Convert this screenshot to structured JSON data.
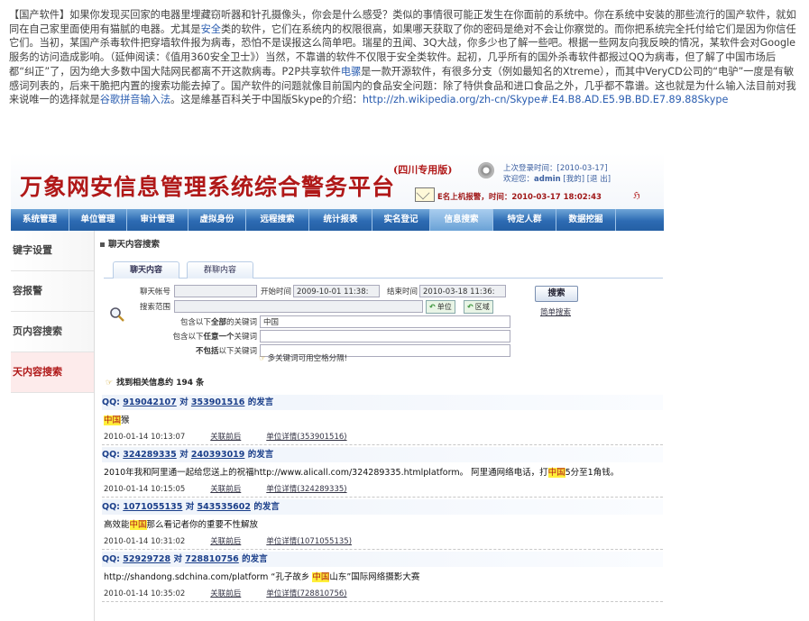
{
  "article": {
    "segments": [
      {
        "t": "【国产软件】如果你发现买回家的电器里埋藏窃听器和针孔摄像头，你会是什么感受？类似的事情很可能正发生在你面前的系统中。你在系统中安装的那些流行的国产软件，就如同在自己家里面使用有猫腻的电器。尤其是",
        "k": false
      },
      {
        "t": "安全",
        "k": true
      },
      {
        "t": "类的软件，它们在系统内的权限很高，如果哪天获取了你的密码是绝对不会让你察觉的。而你把系统完全托付给它们是因为你信任它们。当初，某国产杀毒软件把穿墙软件报为病毒，恐怕不是误报这么简单吧。瑞星的丑闻、3Q大战，你多少也了解一些吧。根据一些网友向我反映的情况，某软件会对Google服务的访问造成影响。（延伸阅读：《值用360安全卫士》）当然，不靠谱的软件不仅限于安全类软件。起初，几乎所有的国外杀毒软件都报过QQ为病毒，但了解了中国市场后都“纠正”了，因为绝大多数中国大陆网民都离不开这款病毒。P2P共享软件",
        "k": false
      },
      {
        "t": "电骡",
        "k": true
      },
      {
        "t": "是一款开源软件，有很多分支（例如最知名的Xtreme），而其中VeryCD公司的“电驴”一度是有敏感词列表的，后来干脆把内置的搜索功能去掉了。国产软件的问题就像目前国内的食品安全问题：除了特供食品和进口食品之外，几乎都不靠谱。这也就是为什么输入法目前对我来说唯一的选择就是",
        "k": false
      },
      {
        "t": "谷歌拼音输入法",
        "k": true
      },
      {
        "t": "。这是維基百科关于中国版Skype的介绍：",
        "k": false
      },
      {
        "t": "http://zh.wikipedia.org/zh-cn/Skype#.E4.B8.AD.E5.9B.BD.E7.89.88Skype",
        "k": true
      }
    ]
  },
  "header": {
    "title": "万象网安信息管理系统综合警务平台",
    "badge": "(四川专用版)",
    "last_login": "上次登录时间：[2010-03-17]",
    "welcome_prefix": "欢迎您：",
    "welcome_user": "admin",
    "welcome_links": "[我的] [退 出]",
    "alert_label": "E名上机报警，",
    "alert_time": "时间：2010-03-17  18:02:43",
    "flag": "ℌ"
  },
  "nav": {
    "items": [
      "系统管理",
      "单位管理",
      "审计管理",
      "虚拟身份",
      "远程搜索",
      "统计报表",
      "实名登记",
      "信息搜索",
      "特定人群",
      "数据挖掘"
    ],
    "active_index": 7
  },
  "sidebar": {
    "items": [
      "键字设置",
      "容报警",
      "页内容搜索",
      "天内容搜索"
    ],
    "active_index": 3
  },
  "content": {
    "breadcrumb": "聊天内容搜索",
    "tabs": [
      "聊天内容",
      "群聊内容"
    ],
    "form": {
      "account_label": "聊天帐号",
      "start_label": "开始时间",
      "start_value": "2009-10-01 11:38:",
      "end_label": "结束时间",
      "end_value": "2010-03-18 11:36:",
      "scope_label": "搜索范围",
      "unit_btn": "单位",
      "region_btn": "区域",
      "all_kw_label_a": "包含以下",
      "all_kw_label_b": "全部",
      "all_kw_label_c": "的关键词",
      "all_kw_value": "中国",
      "any_kw_label_a": "包含以下",
      "any_kw_label_b": "任意一个",
      "any_kw_label_c": "关键词",
      "not_kw_label_a": "不包括",
      "not_kw_label_b": "以下关键词",
      "search_btn": "搜索",
      "simple_link": "简单搜索",
      "tip": "多关键词可用空格分隔!"
    },
    "results": {
      "summary_prefix": "找到相关信息约",
      "count": "194",
      "summary_suffix": "条",
      "records": [
        {
          "qq_prefix": "QQ:",
          "from": "919042107",
          "mid": "对",
          "to": "353901516",
          "suffix": "的发言",
          "pre": "",
          "hl": "中国",
          "post": "猴",
          "time": "2010-01-14 10:13:07",
          "link1": "关联前后",
          "link2": "单位详情(353901516)"
        },
        {
          "qq_prefix": "QQ:",
          "from": "324289335",
          "mid": "对",
          "to": "240393019",
          "suffix": "的发言",
          "pre": "2010年我和阿里通一起给您送上的祝福http://www.alicall.com/324289335.htmlplatform。 阿里通网络电话，打",
          "hl": "中国",
          "post": "5分至1角钱。",
          "time": "2010-01-14 10:15:05",
          "link1": "关联前后",
          "link2": "单位详情(324289335)"
        },
        {
          "qq_prefix": "QQ:",
          "from": "1071055135",
          "mid": "对",
          "to": "543535602",
          "suffix": "的发言",
          "pre": "高效能",
          "hl": "中国",
          "post": "那么看记者你的重要不性解放",
          "time": "2010-01-14 10:31:02",
          "link1": "关联前后",
          "link2": "单位详情(1071055135)"
        },
        {
          "qq_prefix": "QQ:",
          "from": "52929728",
          "mid": "对",
          "to": "728810756",
          "suffix": "的发言",
          "pre": "http://shandong.sdchina.com/platform “孔子故乡 ",
          "hl": "中国",
          "post": "山东”国际网络摄影大赛",
          "time": "2010-01-14 10:35:02",
          "link1": "关联前后",
          "link2": "单位详情(728810756)"
        }
      ]
    }
  },
  "colors": {
    "title_red": "#b01818",
    "nav_blue": "#2d6bb3",
    "qq_blue": "#1b3f8a",
    "highlight_yellow": "#ffef3a",
    "link_blue": "#2a5db0"
  },
  "icons": {
    "gear": "gear-icon",
    "mail": "envelope-icon",
    "magnifier": "magnifier-icon",
    "hand": "pointing-hand-icon"
  }
}
